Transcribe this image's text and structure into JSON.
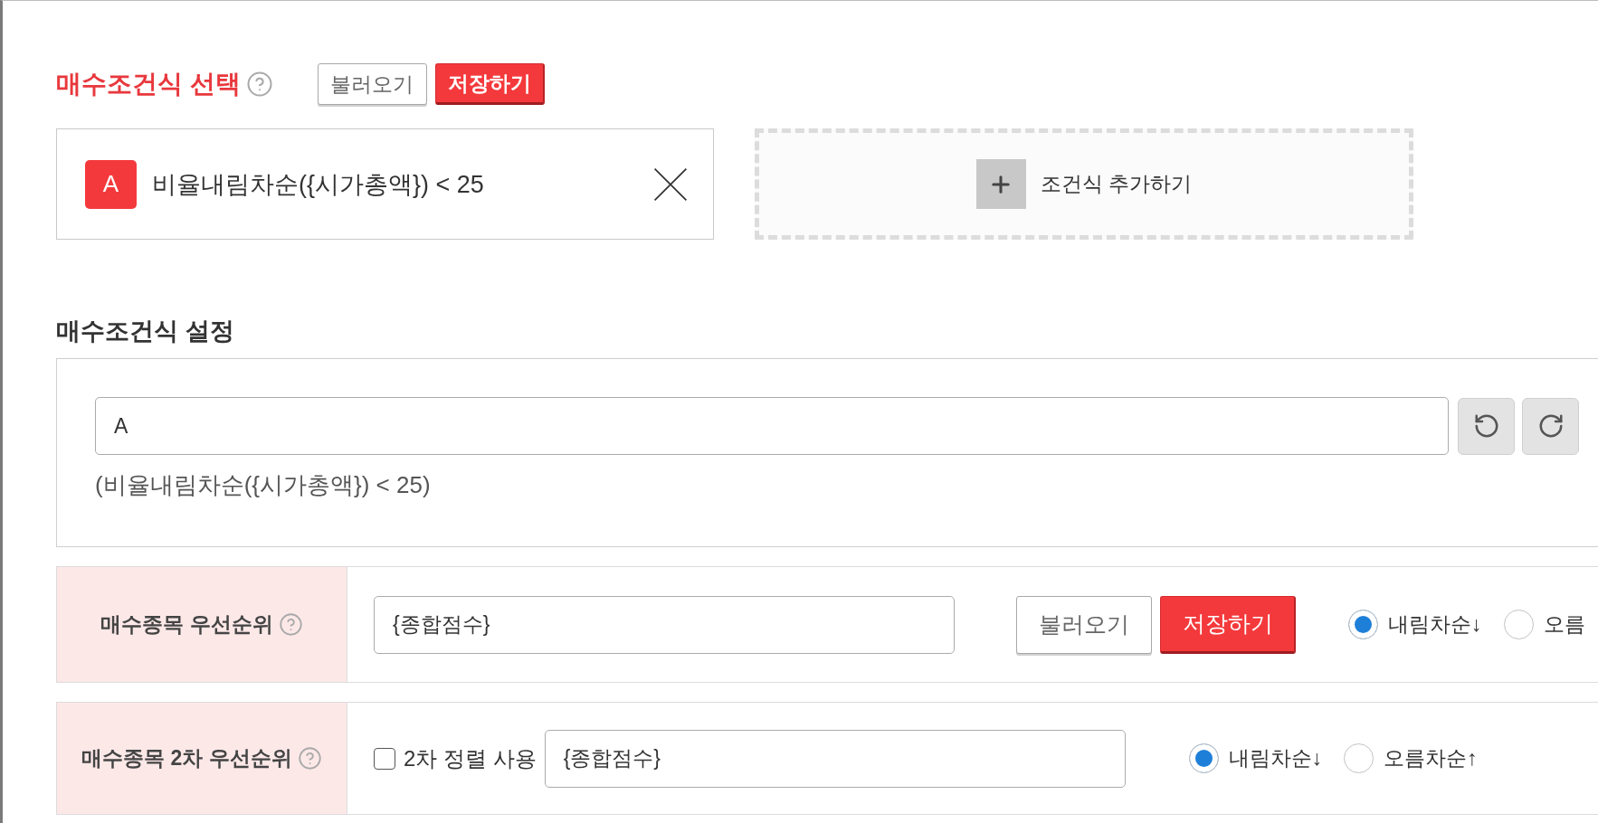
{
  "selection": {
    "title": "매수조건식 선택",
    "buttons": [
      {
        "label": "불러오기",
        "kind": "secondary"
      },
      {
        "label": "저장하기",
        "kind": "primary"
      }
    ],
    "conditions": [
      {
        "badge": "A",
        "expression": "비율내림차순({시가총액}) < 25"
      }
    ],
    "add_label": "조건식 추가하기"
  },
  "settings": {
    "title": "매수조건식 설정",
    "formula": {
      "value": "A"
    },
    "preview": "(비율내림차순({시가총액}) < 25)"
  },
  "priority_rows": [
    {
      "label": "매수종목 우선순위",
      "field": {
        "value": "{종합점수}"
      },
      "buttons": [
        {
          "label": "불러오기",
          "kind": "secondary"
        },
        {
          "label": "저장하기",
          "kind": "primary"
        }
      ],
      "sort_options": [
        {
          "label": "내림차순↓",
          "selected": true
        },
        {
          "label": "오름",
          "selected": false
        }
      ]
    },
    {
      "label": "매수종목 2차 우선순위",
      "checkbox": {
        "label": "2차 정렬 사용",
        "checked": false
      },
      "field": {
        "value": "{종합점수}"
      },
      "sort_options": [
        {
          "label": "내림차순↓",
          "selected": true
        },
        {
          "label": "오름차순↑",
          "selected": false
        }
      ]
    }
  ]
}
